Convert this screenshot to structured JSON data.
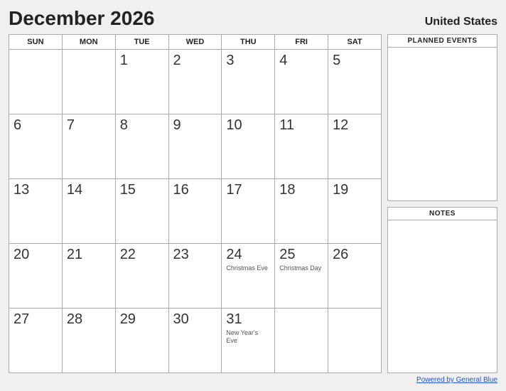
{
  "header": {
    "title": "December 2026",
    "country": "United States"
  },
  "calendar": {
    "days_of_week": [
      "SUN",
      "MON",
      "TUE",
      "WED",
      "THU",
      "FRI",
      "SAT"
    ],
    "weeks": [
      [
        {
          "day": "",
          "event": ""
        },
        {
          "day": "",
          "event": ""
        },
        {
          "day": "1",
          "event": ""
        },
        {
          "day": "2",
          "event": ""
        },
        {
          "day": "3",
          "event": ""
        },
        {
          "day": "4",
          "event": ""
        },
        {
          "day": "5",
          "event": ""
        }
      ],
      [
        {
          "day": "6",
          "event": ""
        },
        {
          "day": "7",
          "event": ""
        },
        {
          "day": "8",
          "event": ""
        },
        {
          "day": "9",
          "event": ""
        },
        {
          "day": "10",
          "event": ""
        },
        {
          "day": "11",
          "event": ""
        },
        {
          "day": "12",
          "event": ""
        }
      ],
      [
        {
          "day": "13",
          "event": ""
        },
        {
          "day": "14",
          "event": ""
        },
        {
          "day": "15",
          "event": ""
        },
        {
          "day": "16",
          "event": ""
        },
        {
          "day": "17",
          "event": ""
        },
        {
          "day": "18",
          "event": ""
        },
        {
          "day": "19",
          "event": ""
        }
      ],
      [
        {
          "day": "20",
          "event": ""
        },
        {
          "day": "21",
          "event": ""
        },
        {
          "day": "22",
          "event": ""
        },
        {
          "day": "23",
          "event": ""
        },
        {
          "day": "24",
          "event": "Christmas Eve"
        },
        {
          "day": "25",
          "event": "Christmas Day"
        },
        {
          "day": "26",
          "event": ""
        }
      ],
      [
        {
          "day": "27",
          "event": ""
        },
        {
          "day": "28",
          "event": ""
        },
        {
          "day": "29",
          "event": ""
        },
        {
          "day": "30",
          "event": ""
        },
        {
          "day": "31",
          "event": "New Year's Eve"
        },
        {
          "day": "",
          "event": ""
        },
        {
          "day": "",
          "event": ""
        }
      ]
    ]
  },
  "sidebar": {
    "planned_events_label": "PLANNED EVENTS",
    "notes_label": "NOTES"
  },
  "footer": {
    "link_text": "Powered by General Blue"
  }
}
